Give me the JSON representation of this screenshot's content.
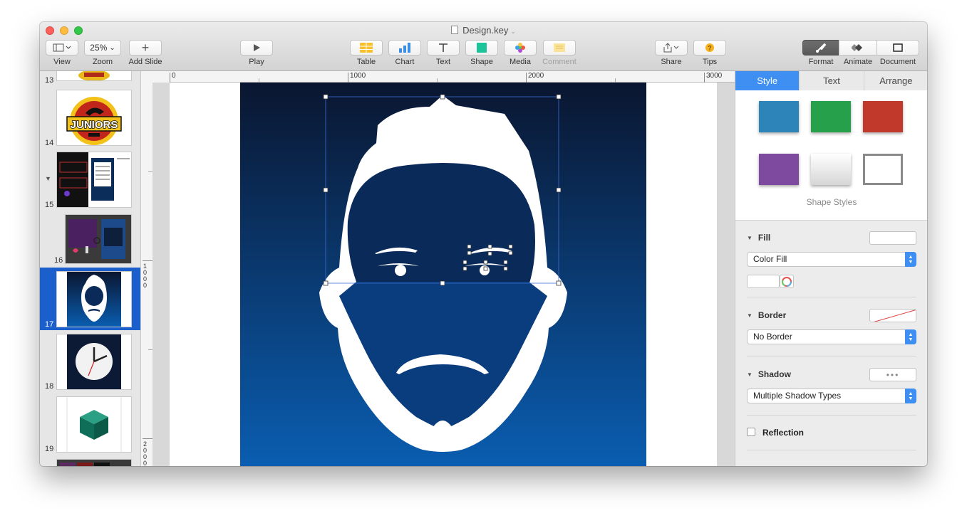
{
  "window": {
    "title": "Design.key"
  },
  "toolbar": {
    "view_label": "View",
    "zoom_value": "25%",
    "zoom_label": "Zoom",
    "add_slide_label": "Add Slide",
    "play_label": "Play",
    "table_label": "Table",
    "chart_label": "Chart",
    "text_label": "Text",
    "shape_label": "Shape",
    "media_label": "Media",
    "comment_label": "Comment",
    "share_label": "Share",
    "tips_label": "Tips",
    "format_label": "Format",
    "animate_label": "Animate",
    "document_label": "Document"
  },
  "slides": [
    {
      "number": "13",
      "label": ""
    },
    {
      "number": "14",
      "label": "JUNIORS"
    },
    {
      "number": "15",
      "label": ""
    },
    {
      "number": "16",
      "label": ""
    },
    {
      "number": "17",
      "label": ""
    },
    {
      "number": "18",
      "label": ""
    },
    {
      "number": "19",
      "label": ""
    }
  ],
  "ruler": {
    "top": [
      "0",
      "1000",
      "2000",
      "3000"
    ],
    "left": [
      "1000",
      "2000"
    ]
  },
  "inspector": {
    "tabs": [
      "Style",
      "Text",
      "Arrange"
    ],
    "active_tab": "Style",
    "shape_styles_label": "Shape Styles",
    "swatch_colors": [
      "#2d84b8",
      "#27a04c",
      "#c0392b",
      "#7d4aa0",
      "#e6e6e6",
      "#ffffff"
    ],
    "fill": {
      "heading": "Fill",
      "popup_value": "Color Fill"
    },
    "border": {
      "heading": "Border",
      "popup_value": "No Border"
    },
    "shadow": {
      "heading": "Shadow",
      "popup_value": "Multiple Shadow Types"
    },
    "reflection_label": "Reflection",
    "reflection_checked": false
  },
  "colors": {
    "accent": "#3f8ef1",
    "slide_bg_top": "#0a1630",
    "slide_bg_bottom": "#0a5db0",
    "selection_row": "#1b5fcc"
  }
}
